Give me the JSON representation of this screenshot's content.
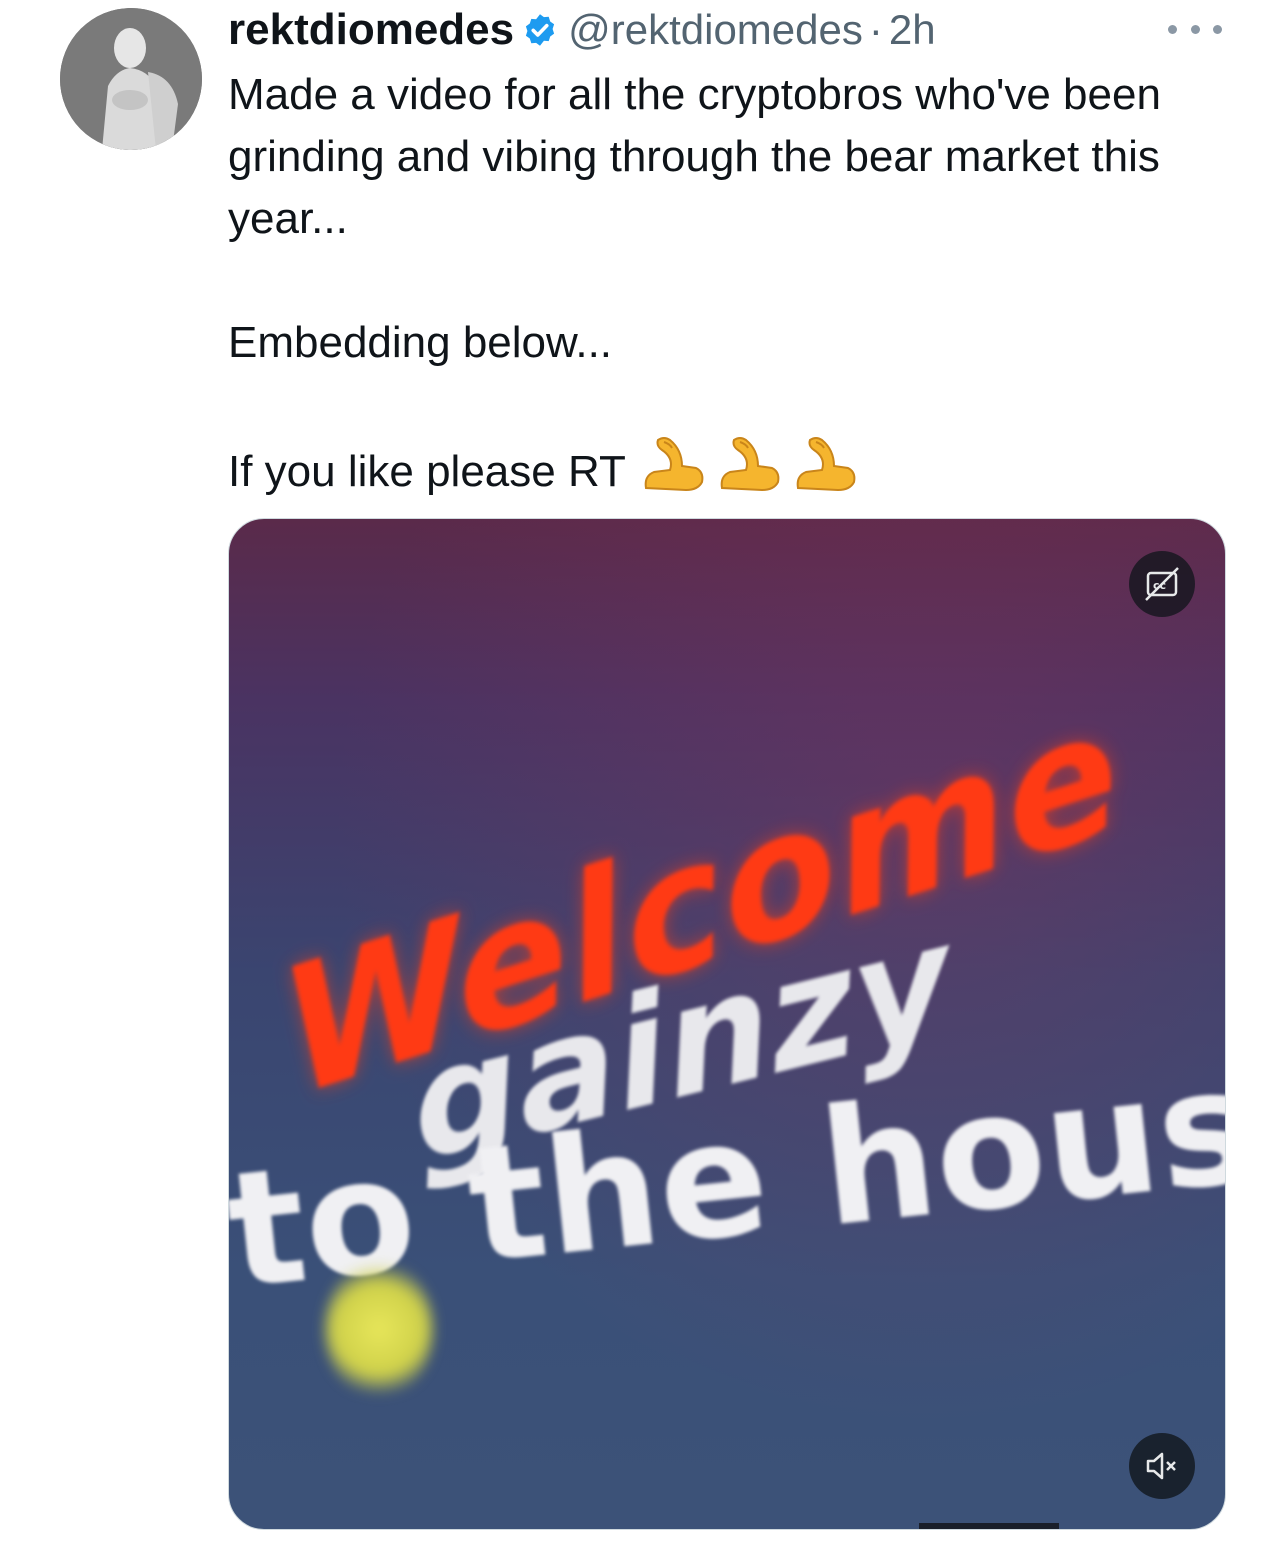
{
  "tweet": {
    "author": {
      "display_name": "rektdiomedes",
      "handle": "@rektdiomedes",
      "verified": true
    },
    "separator": "·",
    "time": "2h",
    "text_lines": [
      "Made a video for all the cryptobros who've been grinding and vibing through the bear market this year...",
      "Embedding below...",
      "If you like please RT"
    ],
    "emoji": [
      "flexed-biceps",
      "flexed-biceps",
      "flexed-biceps"
    ],
    "media": {
      "type": "video",
      "frame_text": [
        "Welcome",
        "gainzy",
        "to the house"
      ],
      "captions_button": "captions-toggle",
      "mute_button": "muted"
    }
  },
  "colors": {
    "text": "#0f1419",
    "secondary": "#536471",
    "verified_badge": "#1d9bf0",
    "welcome_red": "#ff3a14"
  }
}
